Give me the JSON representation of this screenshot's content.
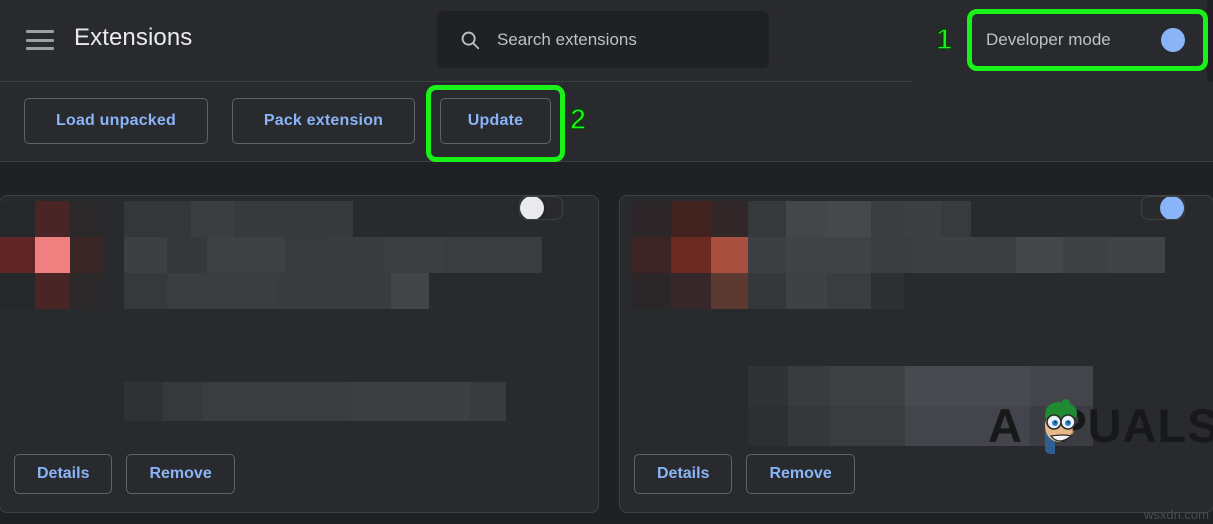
{
  "window": {
    "background": "#202124",
    "surface": "#292a2d",
    "accent_blue": "#8ab4f8",
    "annotation_green": "#18f218"
  },
  "header": {
    "menu_icon": "hamburger-menu-icon",
    "title": "Extensions",
    "search": {
      "icon": "search-icon",
      "placeholder": "Search extensions",
      "value": ""
    },
    "developer_mode": {
      "label": "Developer mode",
      "toggle_state": "on",
      "icon": "toggle-switch-icon"
    }
  },
  "toolbar": {
    "load_unpacked_label": "Load unpacked",
    "pack_extension_label": "Pack extension",
    "update_label": "Update"
  },
  "annotations": [
    {
      "number": "1",
      "target": "developer-mode-toggle",
      "color": "#18f218"
    },
    {
      "number": "2",
      "target": "update-button",
      "color": "#18f218"
    }
  ],
  "cards": [
    {
      "name_redacted": true,
      "details_label": "Details",
      "remove_label": "Remove",
      "enabled_toggle_state": "off",
      "icon_color": "#f08080"
    },
    {
      "name_redacted": true,
      "details_label": "Details",
      "remove_label": "Remove",
      "enabled_toggle_state": "on",
      "icon_color": "#a7503f"
    }
  ],
  "watermarks": {
    "brand": "APPUALS",
    "brand_prefix": "A",
    "brand_suffix": "PUALS",
    "footer": "wsxdn.com"
  }
}
